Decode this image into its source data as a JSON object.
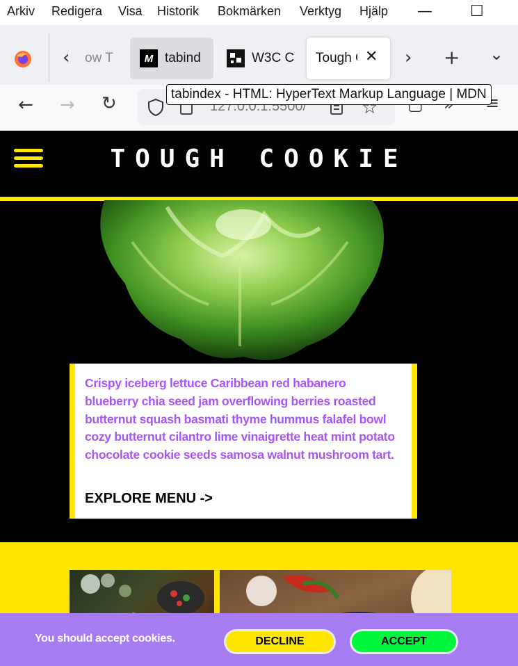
{
  "menubar": {
    "items": [
      "Arkiv",
      "Redigera",
      "Visa",
      "Historik",
      "Bokmärken",
      "Verktyg",
      "Hjälp"
    ],
    "minimize": "—",
    "maximize": "☐"
  },
  "tabs": [
    {
      "label": "ow T"
    },
    {
      "label": "tabind"
    },
    {
      "label": "W3C C"
    },
    {
      "label": "Tough C"
    }
  ],
  "navbar": {
    "url": "127.0.0.1:5500/"
  },
  "tooltip": "tabindex - HTML: HyperText Markup Language | MDN",
  "site": {
    "title": "TOUGH COOKIE",
    "card_text": "Crispy iceberg lettuce Caribbean red habanero blueberry chia seed jam overflowing berries roasted butternut squash basmati thyme hummus falafel bowl cozy butternut cilantro lime vinaigrette heat mint potato chocolate cookie seeds samosa walnut mushroom tart.",
    "explore_link": "EXPLORE MENU ->"
  },
  "cookie_banner": {
    "message": "You should accept cookies.",
    "decline": "DECLINE",
    "accept": "ACCEPT"
  },
  "colors": {
    "accent_yellow": "#ffe600",
    "accent_purple": "#a855f7",
    "banner_purple": "#a77cf2",
    "accept_green": "#00f53d"
  }
}
